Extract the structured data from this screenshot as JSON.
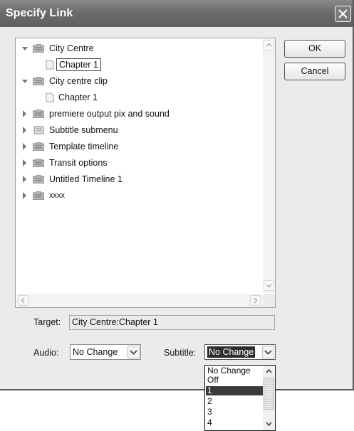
{
  "dialog": {
    "title": "Specify Link",
    "close_icon": "close-x-icon"
  },
  "tree": {
    "items": [
      {
        "label": "City Centre",
        "icon": "folder-icon",
        "expanded": true,
        "level": 0
      },
      {
        "label": "Chapter 1",
        "icon": "page-icon",
        "level": 1,
        "selected": true
      },
      {
        "label": "City centre clip",
        "icon": "folder-icon",
        "expanded": true,
        "level": 0
      },
      {
        "label": "Chapter 1",
        "icon": "page-icon",
        "level": 1
      },
      {
        "label": "premiere output pix and sound",
        "icon": "folder-icon",
        "expanded": false,
        "level": 0
      },
      {
        "label": "Subtitle submenu",
        "icon": "menu-icon",
        "expanded": false,
        "level": 0
      },
      {
        "label": "Template timeline",
        "icon": "folder-icon",
        "expanded": false,
        "level": 0
      },
      {
        "label": "Transit options",
        "icon": "folder-icon",
        "expanded": false,
        "level": 0
      },
      {
        "label": "Untitled Timeline 1",
        "icon": "folder-icon",
        "expanded": false,
        "level": 0
      },
      {
        "label": "xxxx",
        "icon": "folder-icon",
        "expanded": false,
        "level": 0
      }
    ]
  },
  "buttons": {
    "ok": "OK",
    "cancel": "Cancel"
  },
  "form": {
    "target_label": "Target:",
    "target_value": "City Centre:Chapter 1",
    "audio_label": "Audio:",
    "audio_value": "No Change",
    "subtitle_label": "Subtitle:",
    "subtitle_value": "No Change"
  },
  "subtitle_dropdown": {
    "options": [
      "No Change",
      "Off",
      "1",
      "2",
      "3",
      "4"
    ],
    "selected": "1"
  },
  "colors": {
    "titlebar": "#6c6c6c",
    "dialog_bg": "#ebebeb",
    "selection": "#3a3a3a"
  }
}
